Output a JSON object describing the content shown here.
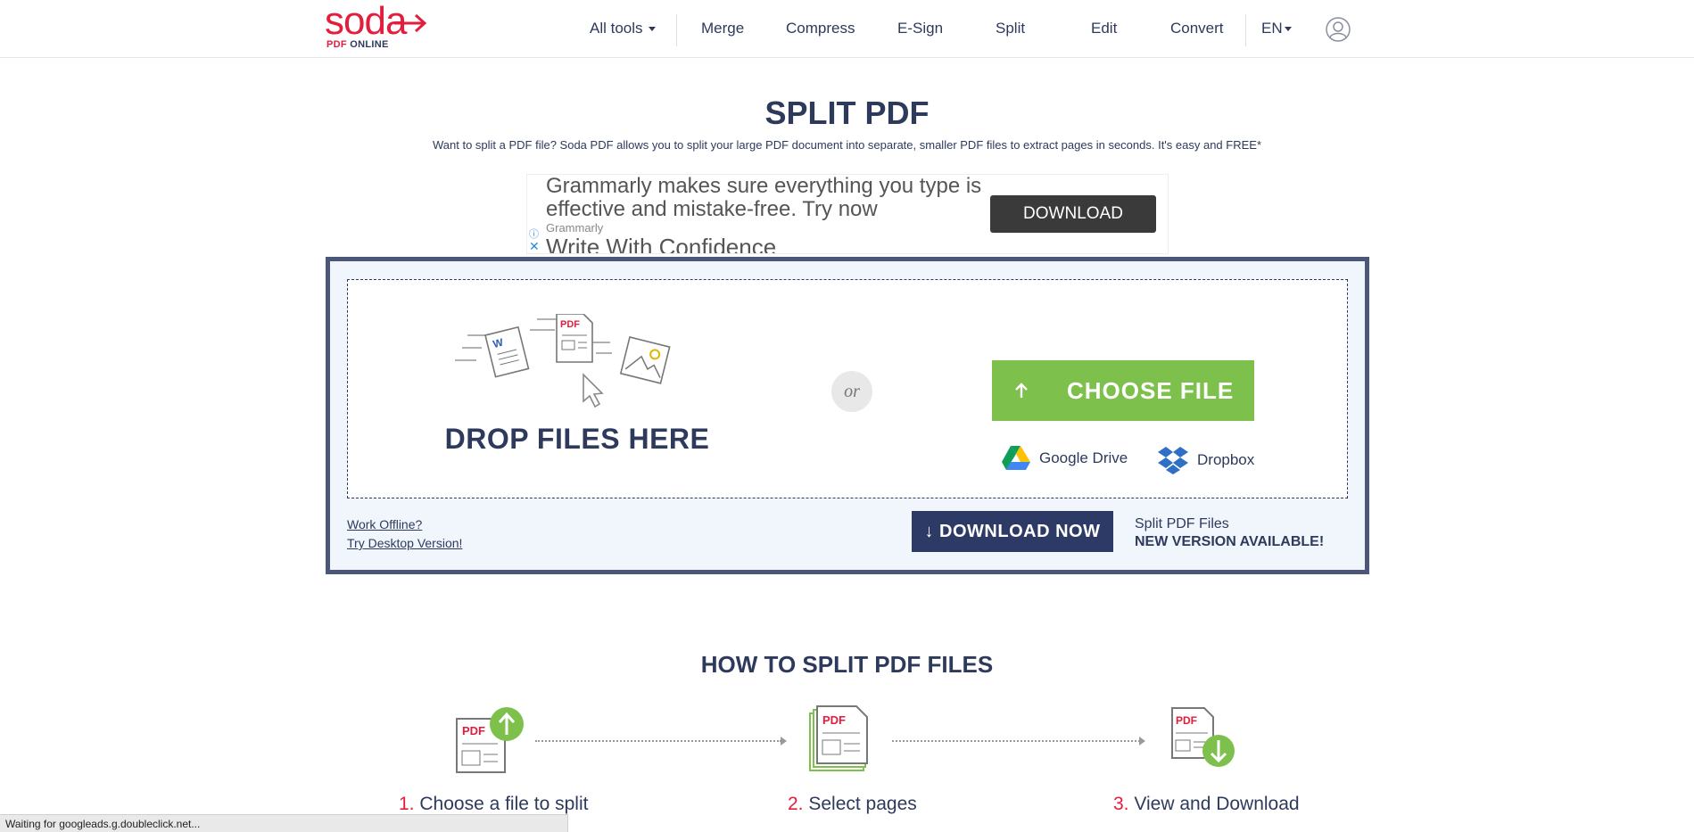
{
  "logo": {
    "main": "soda",
    "sub_pdf": "PDF",
    "sub_online": "ONLINE"
  },
  "nav": {
    "all_tools": "All tools",
    "merge": "Merge",
    "compress": "Compress",
    "esign": "E-Sign",
    "split": "Split",
    "edit": "Edit",
    "convert": "Convert",
    "language": "EN"
  },
  "page": {
    "title": "SPLIT PDF",
    "description": "Want to split a PDF file? Soda PDF allows you to split your large PDF document into separate, smaller PDF files to extract pages in seconds. It's easy and FREE*"
  },
  "ad": {
    "headline": "Grammarly makes sure everything you type is effective and mistake-free. Try now",
    "brand": "Grammarly",
    "title": "Write With Confidence",
    "button": "DOWNLOAD",
    "info_icon": "ⓘ",
    "close_icon": "✕"
  },
  "upload": {
    "drop_label": "DROP FILES HERE",
    "or": "or",
    "choose_file": "CHOOSE FILE",
    "google_drive": "Google Drive",
    "dropbox": "Dropbox",
    "work_offline": "Work Offline?",
    "try_desktop": "Try Desktop Version!",
    "download_now": "↓ DOWNLOAD NOW",
    "version_line1": "Split PDF Files",
    "version_line2": "NEW VERSION AVAILABLE!"
  },
  "how_to": {
    "title": "HOW TO SPLIT PDF FILES",
    "steps": [
      {
        "num": "1.",
        "label": "Choose a file to split"
      },
      {
        "num": "2.",
        "label": "Select pages"
      },
      {
        "num": "3.",
        "label": "View and Download"
      }
    ]
  },
  "status_bar": "Waiting for googleads.g.doubleclick.net...",
  "colors": {
    "brand_red": "#e31d3c",
    "navy": "#2e3a5c",
    "green": "#7dc04b",
    "panel_bg": "#f1f6fc"
  }
}
